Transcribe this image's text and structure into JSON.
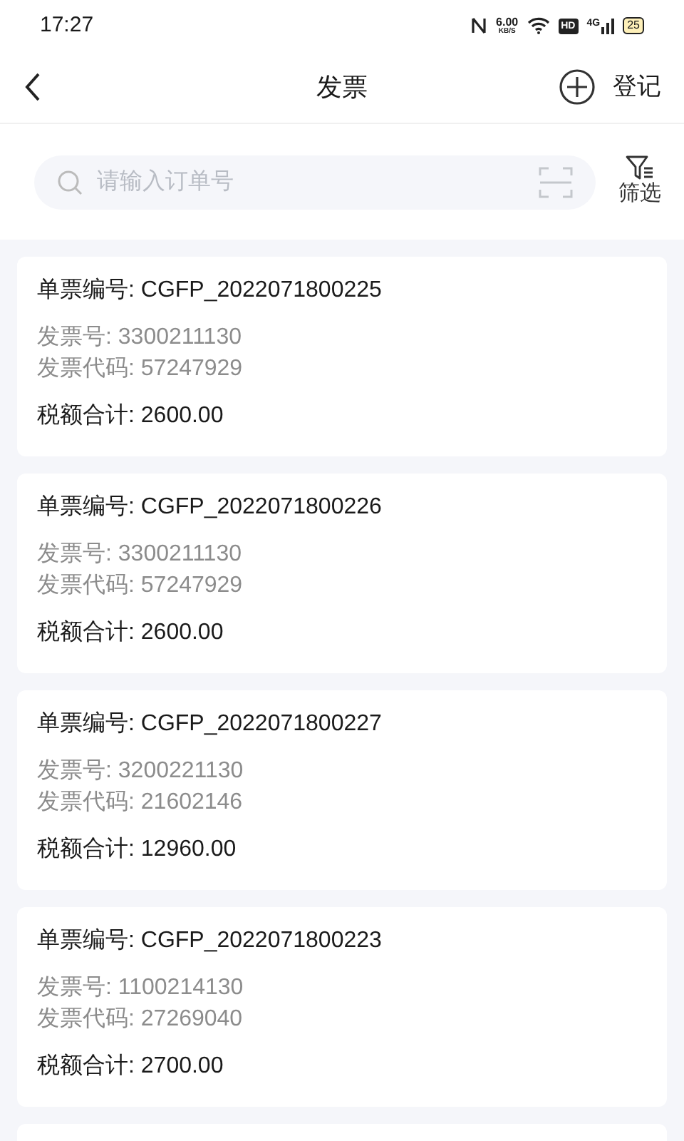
{
  "status_bar": {
    "time": "17:27",
    "speed": "6.00",
    "speed_unit": "KB/S",
    "hd": "HD",
    "network": "4G",
    "battery": "25"
  },
  "header": {
    "title": "发票",
    "action": "登记"
  },
  "search": {
    "placeholder": "请输入订单号",
    "filter": "筛选"
  },
  "invoices": [
    {
      "number": "单票编号: CGFP_2022071800225",
      "invoice_no": "发票号: 3300211130",
      "invoice_code": "发票代码: 57247929",
      "total": "税额合计: 2600.00"
    },
    {
      "number": "单票编号: CGFP_2022071800226",
      "invoice_no": "发票号: 3300211130",
      "invoice_code": "发票代码: 57247929",
      "total": "税额合计: 2600.00"
    },
    {
      "number": "单票编号: CGFP_2022071800227",
      "invoice_no": "发票号: 3200221130",
      "invoice_code": "发票代码: 21602146",
      "total": "税额合计: 12960.00"
    },
    {
      "number": "单票编号: CGFP_2022071800223",
      "invoice_no": "发票号: 1100214130",
      "invoice_code": "发票代码: 27269040",
      "total": "税额合计: 2700.00"
    }
  ]
}
